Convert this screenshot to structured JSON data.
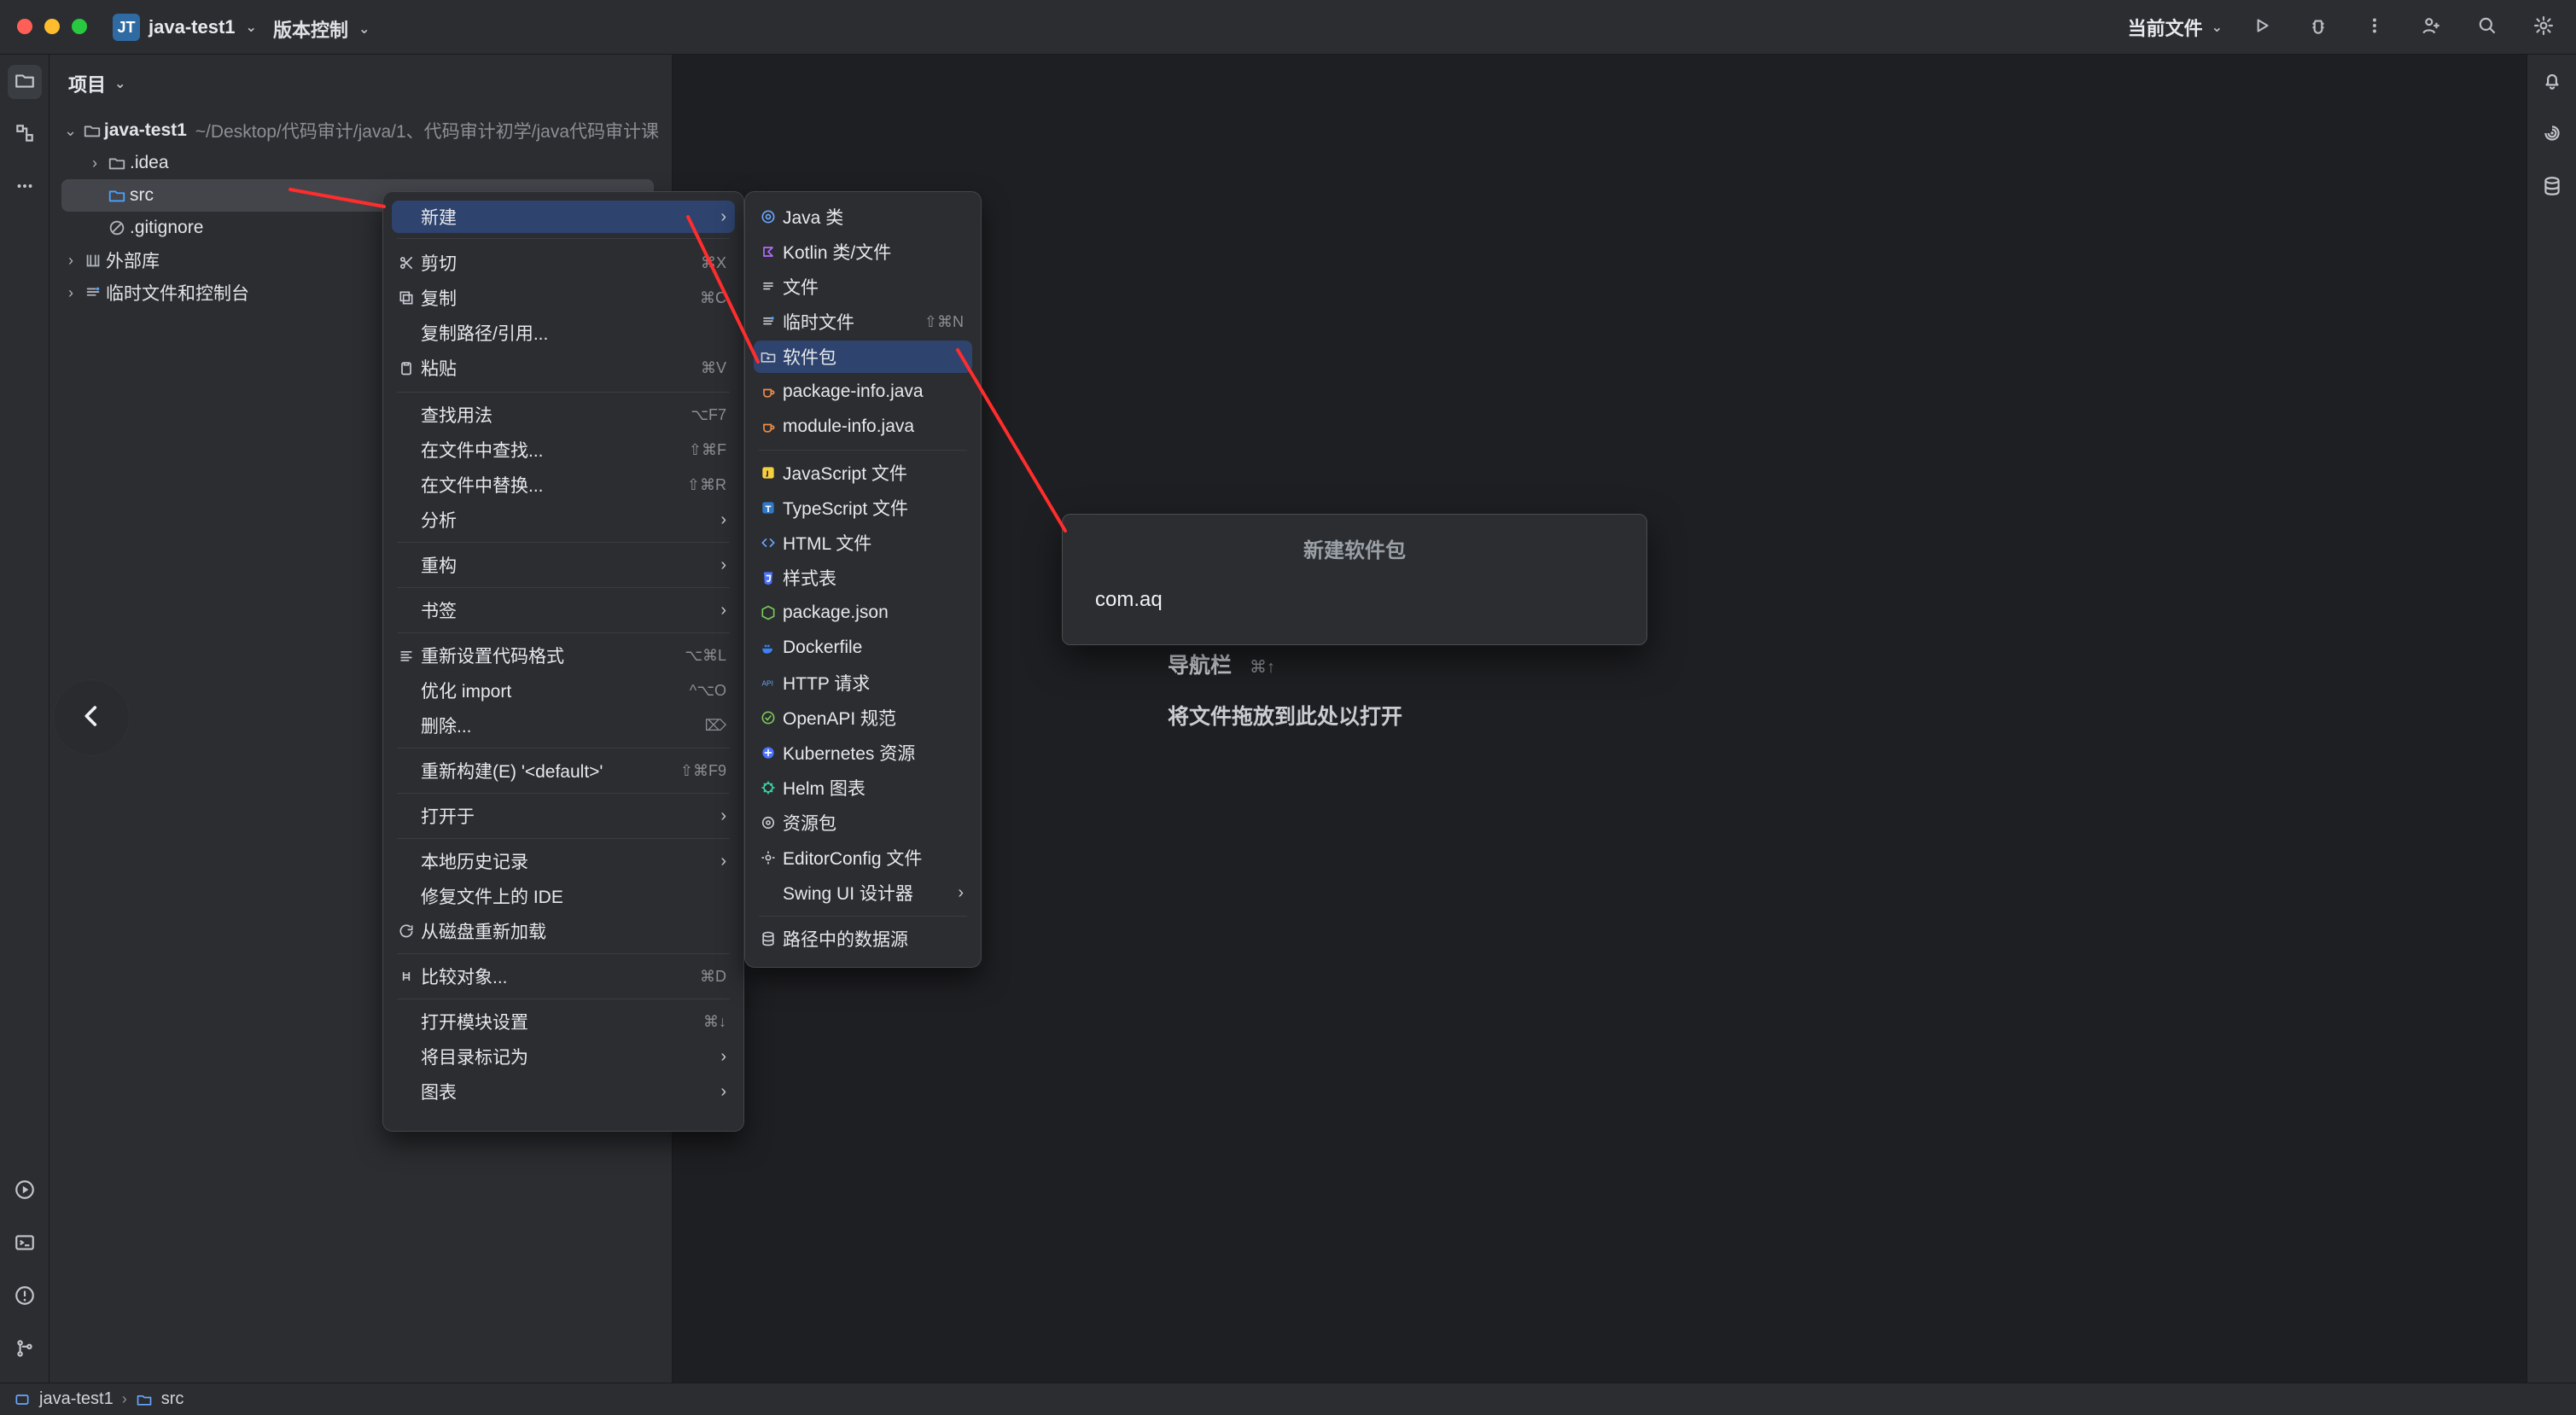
{
  "titlebar": {
    "project_badge": "JT",
    "project_name": "java-test1",
    "vcs_label": "版本控制",
    "current_file_label": "当前文件"
  },
  "project_panel": {
    "title": "项目",
    "tree": {
      "root_name": "java-test1",
      "root_path": "~/Desktop/代码审计/java/1、代码审计初学/java代码审计课",
      "items": [
        {
          "label": ".idea"
        },
        {
          "label": "src"
        },
        {
          "label": ".gitignore"
        },
        {
          "label": "外部库"
        },
        {
          "label": "临时文件和控制台"
        }
      ]
    }
  },
  "context_menu": {
    "items": [
      {
        "label": "新建",
        "shortcut": "",
        "submenu": "›"
      },
      {
        "label": "剪切",
        "shortcut": "⌘X",
        "submenu": ""
      },
      {
        "label": "复制",
        "shortcut": "⌘C",
        "submenu": ""
      },
      {
        "label": "复制路径/引用...",
        "shortcut": "",
        "submenu": ""
      },
      {
        "label": "粘贴",
        "shortcut": "⌘V",
        "submenu": ""
      },
      {
        "label": "查找用法",
        "shortcut": "⌥F7",
        "submenu": ""
      },
      {
        "label": "在文件中查找...",
        "shortcut": "⇧⌘F",
        "submenu": ""
      },
      {
        "label": "在文件中替换...",
        "shortcut": "⇧⌘R",
        "submenu": ""
      },
      {
        "label": "分析",
        "shortcut": "",
        "submenu": "›"
      },
      {
        "label": "重构",
        "shortcut": "",
        "submenu": "›"
      },
      {
        "label": "书签",
        "shortcut": "",
        "submenu": "›"
      },
      {
        "label": "重新设置代码格式",
        "shortcut": "⌥⌘L",
        "submenu": ""
      },
      {
        "label": "优化 import",
        "shortcut": "^⌥O",
        "submenu": ""
      },
      {
        "label": "删除...",
        "shortcut": "⌦",
        "submenu": ""
      },
      {
        "label": "重新构建(E) '<default>'",
        "shortcut": "⇧⌘F9",
        "submenu": ""
      },
      {
        "label": "打开于",
        "shortcut": "",
        "submenu": "›"
      },
      {
        "label": "本地历史记录",
        "shortcut": "",
        "submenu": "›"
      },
      {
        "label": "修复文件上的 IDE",
        "shortcut": "",
        "submenu": ""
      },
      {
        "label": "从磁盘重新加载",
        "shortcut": "",
        "submenu": ""
      },
      {
        "label": "比较对象...",
        "shortcut": "⌘D",
        "submenu": ""
      },
      {
        "label": "打开模块设置",
        "shortcut": "⌘↓",
        "submenu": ""
      },
      {
        "label": "将目录标记为",
        "shortcut": "",
        "submenu": "›"
      },
      {
        "label": "图表",
        "shortcut": "",
        "submenu": "›"
      }
    ]
  },
  "new_submenu": {
    "items": [
      {
        "label": "Java 类",
        "shortcut": "",
        "submenu": ""
      },
      {
        "label": "Kotlin 类/文件",
        "shortcut": "",
        "submenu": ""
      },
      {
        "label": "文件",
        "shortcut": "",
        "submenu": ""
      },
      {
        "label": "临时文件",
        "shortcut": "⇧⌘N",
        "submenu": ""
      },
      {
        "label": "软件包",
        "shortcut": "",
        "submenu": ""
      },
      {
        "label": "package-info.java",
        "shortcut": "",
        "submenu": ""
      },
      {
        "label": "module-info.java",
        "shortcut": "",
        "submenu": ""
      },
      {
        "label": "JavaScript 文件",
        "shortcut": "",
        "submenu": ""
      },
      {
        "label": "TypeScript 文件",
        "shortcut": "",
        "submenu": ""
      },
      {
        "label": "HTML 文件",
        "shortcut": "",
        "submenu": ""
      },
      {
        "label": "样式表",
        "shortcut": "",
        "submenu": ""
      },
      {
        "label": "package.json",
        "shortcut": "",
        "submenu": ""
      },
      {
        "label": "Dockerfile",
        "shortcut": "",
        "submenu": ""
      },
      {
        "label": "HTTP 请求",
        "shortcut": "",
        "submenu": ""
      },
      {
        "label": "OpenAPI 规范",
        "shortcut": "",
        "submenu": ""
      },
      {
        "label": "Kubernetes 资源",
        "shortcut": "",
        "submenu": ""
      },
      {
        "label": "Helm 图表",
        "shortcut": "",
        "submenu": ""
      },
      {
        "label": "资源包",
        "shortcut": "",
        "submenu": ""
      },
      {
        "label": "EditorConfig 文件",
        "shortcut": "",
        "submenu": ""
      },
      {
        "label": "Swing UI 设计器",
        "shortcut": "",
        "submenu": "›"
      },
      {
        "label": "路径中的数据源",
        "shortcut": "",
        "submenu": ""
      }
    ]
  },
  "dialog": {
    "title": "新建软件包",
    "value": "com.aq"
  },
  "editor": {
    "nav_hint": "导航栏",
    "nav_shortcut": "⌘↑",
    "drop_hint": "将文件拖放到此处以打开"
  },
  "statusbar": {
    "crumb1": "java-test1",
    "crumb2": "src"
  },
  "colors": {
    "highlight": "#2e436e",
    "annotation_red": "#ff2d2d"
  }
}
